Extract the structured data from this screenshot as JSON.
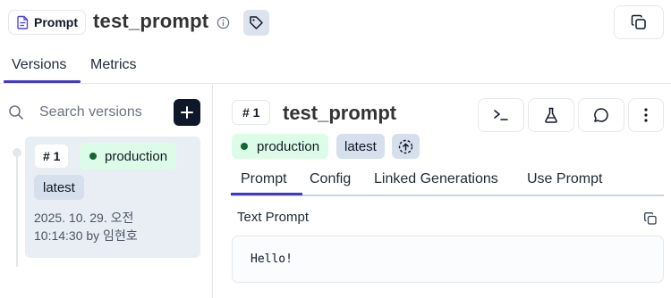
{
  "header": {
    "type_badge": "Prompt",
    "title": "test_prompt"
  },
  "tabs": [
    {
      "label": "Versions",
      "active": true
    },
    {
      "label": "Metrics",
      "active": false
    }
  ],
  "sidebar": {
    "search_placeholder": "Search versions",
    "versions": [
      {
        "number": "# 1",
        "labels": [
          "production",
          "latest"
        ],
        "date": "2025. 10. 29. 오전",
        "time_author": "10:14:30 by 임현호"
      }
    ]
  },
  "main": {
    "version_number": "# 1",
    "title": "test_prompt",
    "labels": {
      "production": "production",
      "latest": "latest"
    },
    "subtabs": [
      "Prompt",
      "Config",
      "Linked Generations",
      "Use Prompt"
    ],
    "active_subtab": "Prompt",
    "section_label": "Text Prompt",
    "prompt_text": "Hello!"
  },
  "colors": {
    "accent": "#4338ca",
    "production_bg": "#dcfce7",
    "production_dot": "#166534",
    "latest_bg": "#d6dfec",
    "add_button_bg": "#0f172a"
  },
  "icons": [
    "prompt-file-icon",
    "info-icon",
    "tag-icon",
    "copy-icon",
    "search-icon",
    "plus-icon",
    "terminal-icon",
    "flask-icon",
    "comment-icon",
    "more-vertical-icon",
    "promote-icon"
  ]
}
